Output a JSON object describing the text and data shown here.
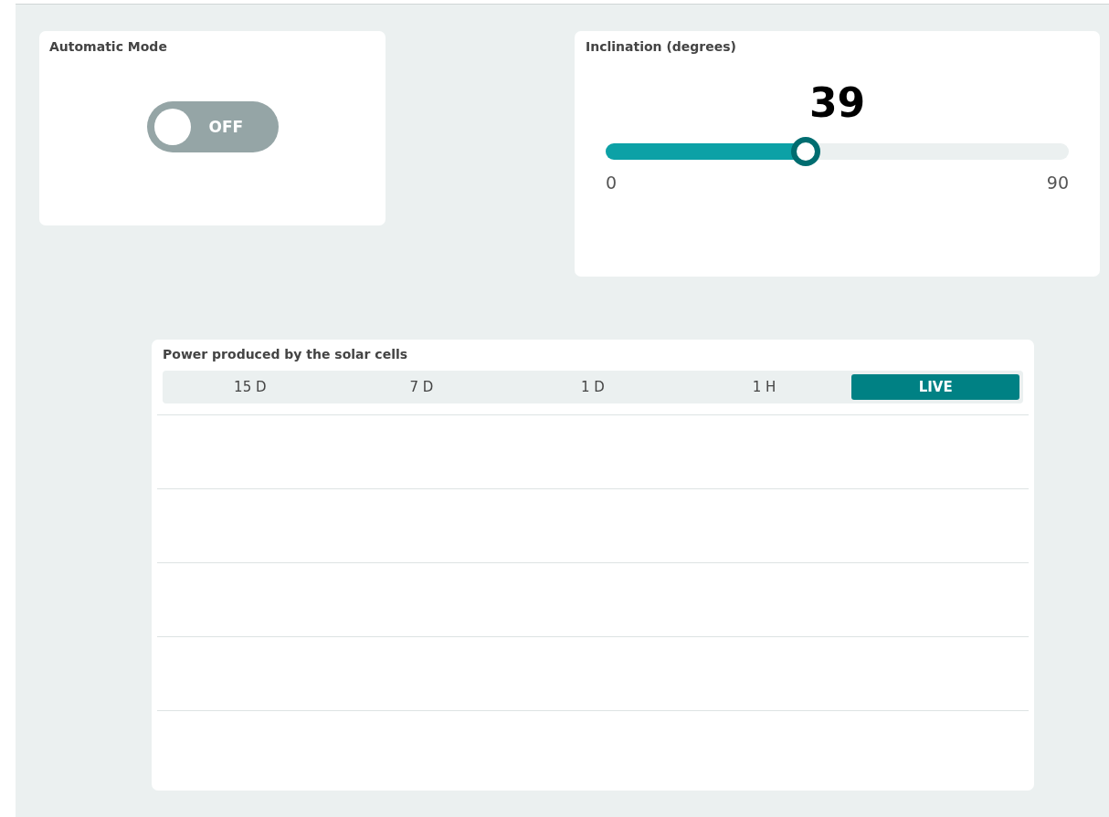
{
  "automatic_mode": {
    "title": "Automatic Mode",
    "switch": {
      "on": false,
      "label": "OFF"
    }
  },
  "inclination": {
    "title": "Inclination (degrees)",
    "value": "39",
    "slider": {
      "level": 0.433,
      "min_label": "0",
      "max_label": "90"
    }
  },
  "power_chart": {
    "title": "Power produced by the solar cells",
    "tabs": [
      {
        "label": "15 D",
        "selected": false
      },
      {
        "label": "7 D",
        "selected": false
      },
      {
        "label": "1 D",
        "selected": false
      },
      {
        "label": "1 H",
        "selected": false
      },
      {
        "label": "LIVE",
        "selected": true
      }
    ]
  }
}
